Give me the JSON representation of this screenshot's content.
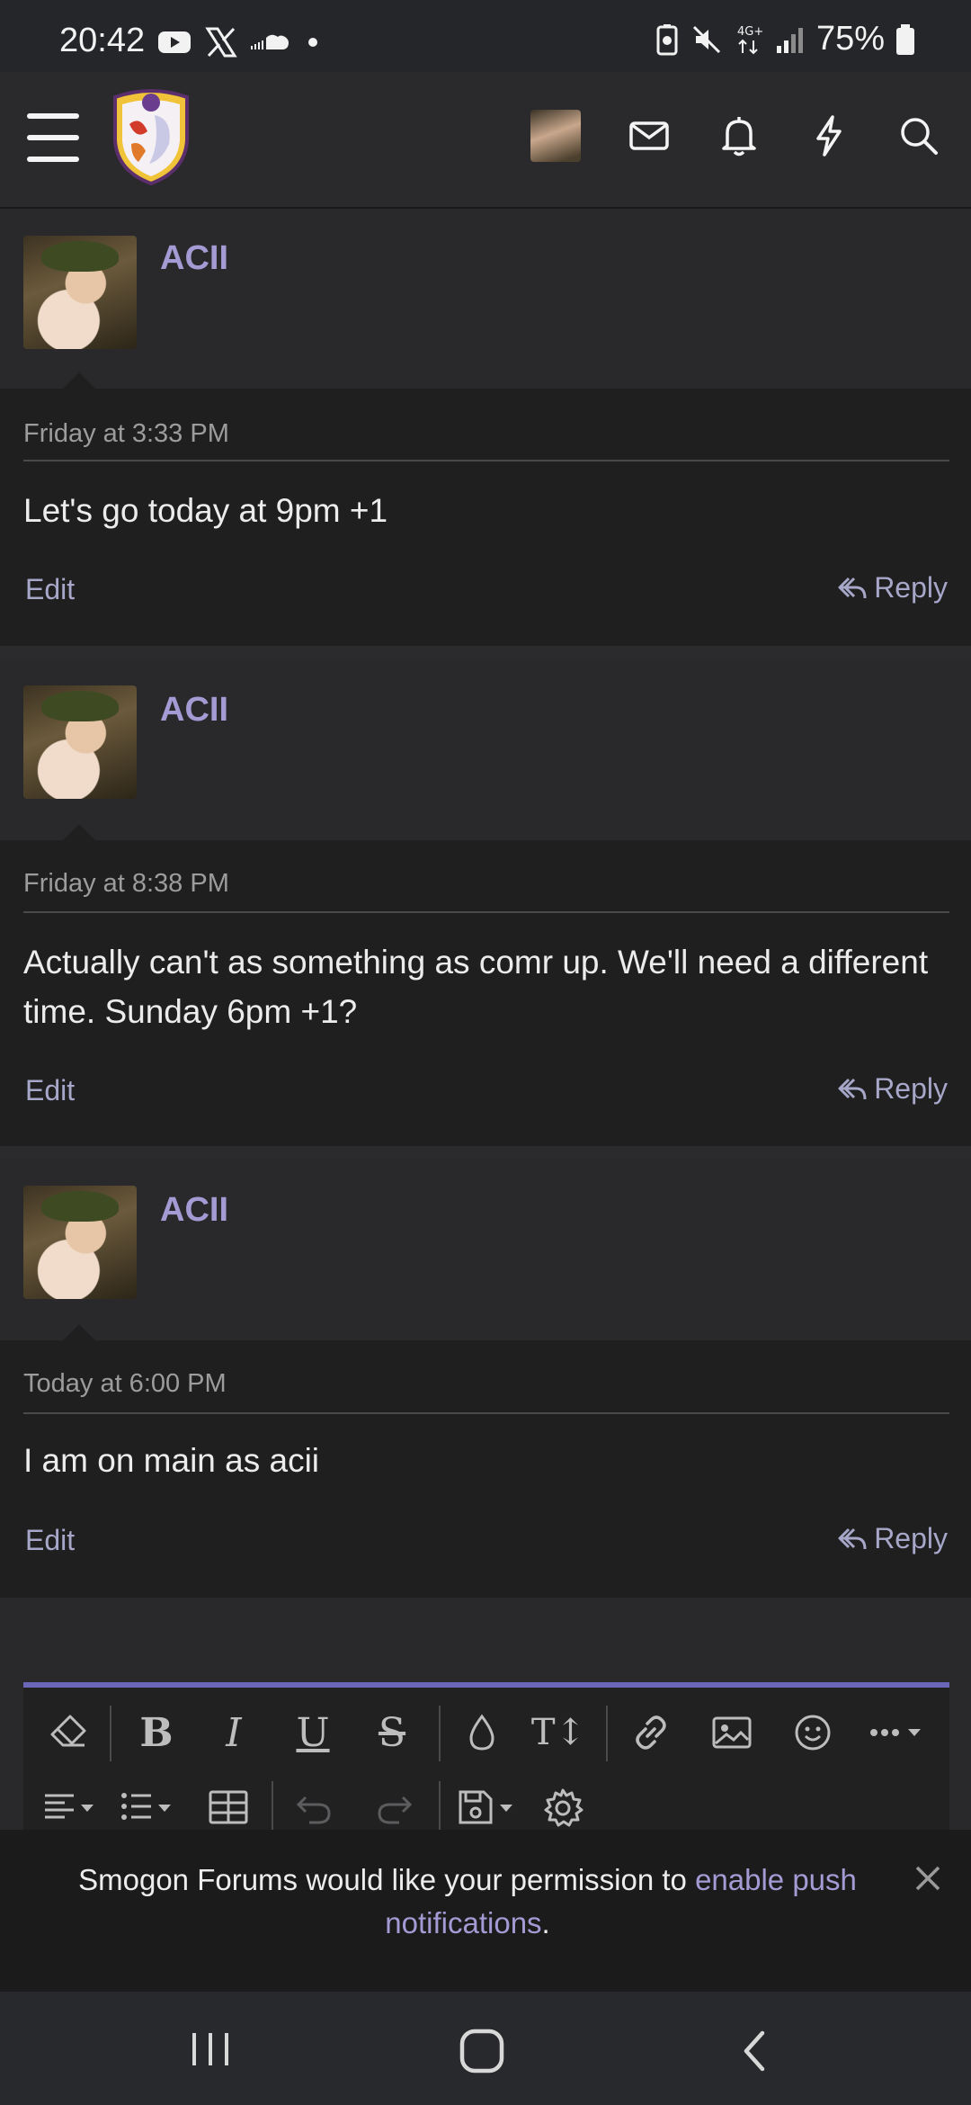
{
  "status": {
    "time": "20:42",
    "battery_percent": "75%"
  },
  "posts": [
    {
      "username": "ACII",
      "date": "Friday at 3:33 PM",
      "message": "Let's go today at 9pm +1",
      "edit_label": "Edit",
      "reply_label": "Reply"
    },
    {
      "username": "ACII",
      "date": "Friday at 8:38 PM",
      "message": "Actually can't as something as comr up. We'll need a different time. Sunday 6pm +1?",
      "edit_label": "Edit",
      "reply_label": "Reply"
    },
    {
      "username": "ACII",
      "date": "Today at 6:00 PM",
      "message": "I am on main as acii",
      "edit_label": "Edit",
      "reply_label": "Reply"
    }
  ],
  "banner": {
    "text_before": "Smogon Forums would like your permission to ",
    "link_text": "enable push notifications",
    "text_after": "."
  },
  "toolbar": {
    "bold": "B",
    "italic": "I",
    "underline": "U",
    "strike": "S",
    "text_size": "T↕"
  },
  "colors": {
    "accent": "#6b67b8",
    "username": "#a59bd4",
    "link": "#a59bd4"
  }
}
